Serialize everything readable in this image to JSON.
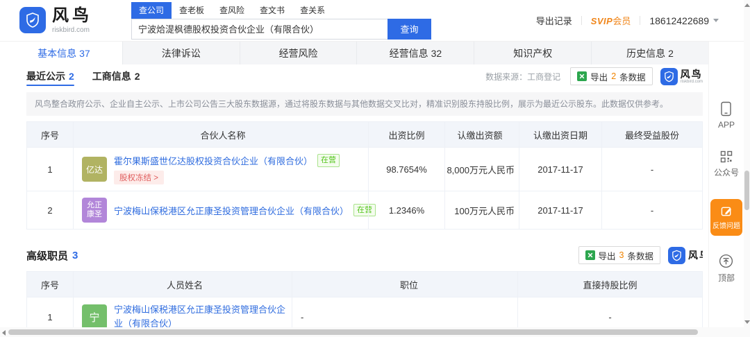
{
  "header": {
    "brand": {
      "name": "风鸟",
      "domain": "riskbird.com"
    },
    "nav_tabs": [
      {
        "label": "查公司"
      },
      {
        "label": "查老板"
      },
      {
        "label": "查风险"
      },
      {
        "label": "查文书"
      },
      {
        "label": "查关系"
      }
    ],
    "search": {
      "value": "宁波烚湜枫德股权投资合伙企业（有限合伙）",
      "button": "查询"
    },
    "user": {
      "export_record": "导出记录",
      "svip_brand": "SVIP",
      "svip_suffix": "会员",
      "phone": "18612422689"
    }
  },
  "tabbar": [
    {
      "label": "基本信息",
      "count": "37"
    },
    {
      "label": "法律诉讼",
      "count": ""
    },
    {
      "label": "经营风险",
      "count": ""
    },
    {
      "label": "经营信息",
      "count": "32"
    },
    {
      "label": "知识产权",
      "count": ""
    },
    {
      "label": "历史信息",
      "count": "2"
    }
  ],
  "partners": {
    "subtabs": [
      {
        "label": "最近公示",
        "count": "2"
      },
      {
        "label": "工商信息",
        "count": "2"
      }
    ],
    "source": "数据来源：工商登记",
    "export": {
      "prefix": "导出",
      "count": "2",
      "suffix": "条数据"
    },
    "watermark": {
      "name": "风鸟",
      "domain": "riskbird.com"
    },
    "notice": "风鸟整合政府公示、企业自主公示、上市公司公告三大股东数据源，通过将股东数据与其他数据交叉比对，精准识别股东持股比例，展示为最近公示股东。此数据仅供参考。",
    "columns": [
      "序号",
      "合伙人名称",
      "出资比例",
      "认缴出资额",
      "认缴出资日期",
      "最终受益股份"
    ],
    "rows": [
      {
        "no": "1",
        "avatar": "亿达",
        "name": "霍尔果斯盛世亿达股权投资合伙企业（有限合伙）",
        "status": "在营",
        "tag": "股权冻结 >",
        "ratio": "98.7654%",
        "amount": "8,000万元人民币",
        "date": "2017-11-17",
        "final_share": "-"
      },
      {
        "no": "2",
        "avatar": "允正康圣",
        "name": "宁波梅山保税港区允正康圣投资管理合伙企业（有限合伙）",
        "status": "在营",
        "ratio": "1.2346%",
        "amount": "100万元人民币",
        "date": "2017-11-17",
        "final_share": "-"
      }
    ]
  },
  "executives": {
    "title": "高级职员",
    "count": "3",
    "export": {
      "prefix": "导出",
      "count": "3",
      "suffix": "条数据"
    },
    "watermark": {
      "name": "风鸟"
    },
    "columns": [
      "序号",
      "人员姓名",
      "职位",
      "直接持股比例"
    ],
    "rows": [
      {
        "no": "1",
        "avatar": "宁",
        "name": "宁波梅山保税港区允正康圣投资管理合伙企业（有限合伙）",
        "position": "-",
        "share": "-"
      }
    ]
  },
  "rail": {
    "app": "APP",
    "wechat": "公众号",
    "feedback": "反馈问题",
    "top": "顶部"
  },
  "colors": {
    "brand_blue": "#2e6be5",
    "link_blue": "#2f6cdf",
    "orange_accent": "#fa8c16",
    "status_green": "#52c41a",
    "freeze_red": "#e05d5d",
    "avatar_row1": "#b1b362",
    "avatar_row2": "#b286d9",
    "avatar_exec": "#74bf6b"
  }
}
